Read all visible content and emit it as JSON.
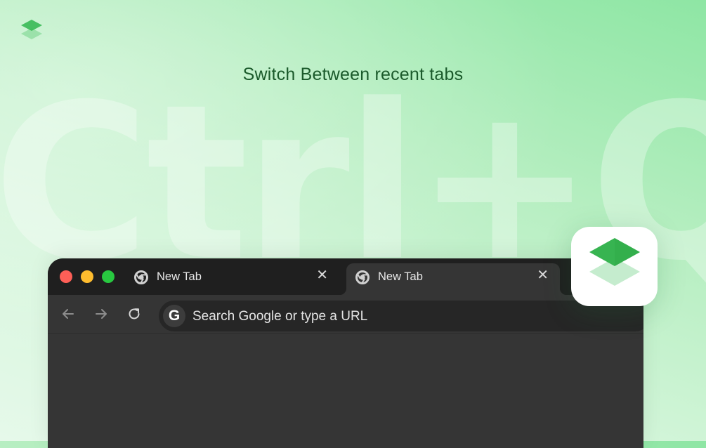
{
  "headline": "Switch Between recent tabs",
  "shortcut": "Ctrl+Q",
  "browser": {
    "tabs": [
      {
        "title": "New Tab",
        "close": "✕",
        "active": false
      },
      {
        "title": "New Tab",
        "close": "✕",
        "active": true
      }
    ],
    "toolbar": {
      "back_icon": "arrow-left-icon",
      "forward_icon": "arrow-right-icon",
      "reload_icon": "reload-icon"
    },
    "omnibox": {
      "badge": "G",
      "placeholder": "Search Google or type a URL"
    },
    "traffic_light_colors": {
      "close": "#fe5f57",
      "minimize": "#febc2e",
      "maximize": "#28c840"
    }
  },
  "colors": {
    "accent_green": "#3fbf5c",
    "headline": "#1b5a2b",
    "browser_frame": "#1f1f1f",
    "browser_body": "#353535"
  }
}
